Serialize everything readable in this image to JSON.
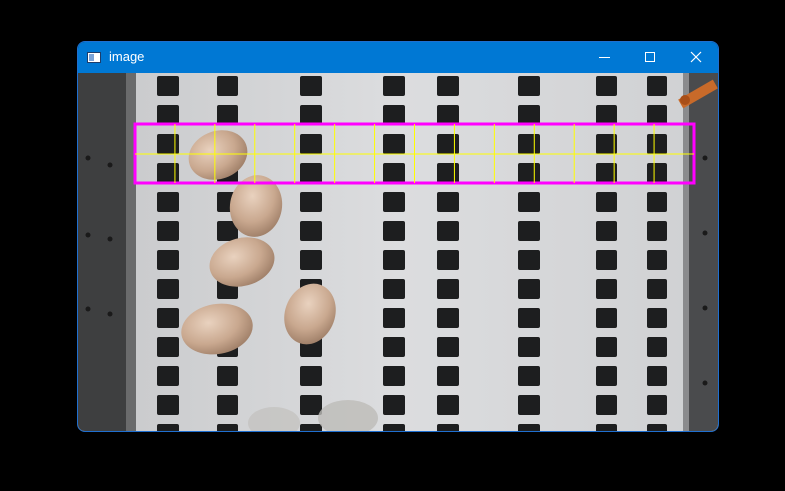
{
  "window": {
    "title": "image",
    "controls": {
      "minimize": "minimize",
      "maximize": "maximize",
      "close": "close"
    }
  },
  "image": {
    "description_icon": "camera-frame",
    "overlay_box_color": "#ff00ff",
    "grid_color": "#ffff00",
    "grid_columns": 14,
    "grid_rows": 2
  }
}
